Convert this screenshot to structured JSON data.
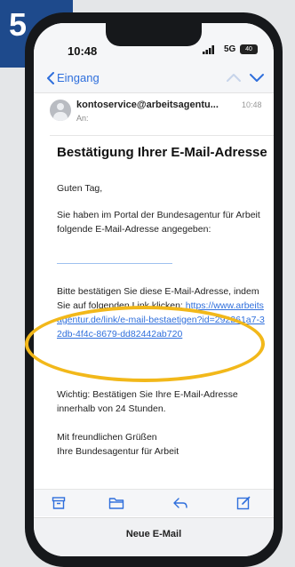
{
  "step": "5",
  "status": {
    "time": "10:48",
    "network": "5G",
    "battery": "40"
  },
  "nav": {
    "back_label": "Eingang"
  },
  "email": {
    "sender": "kontoservice@arbeitsagentu...",
    "time": "10:48",
    "to_label": "An:",
    "subject": "Bestätigung Ihrer E-Mail-Adresse",
    "greeting": "Guten Tag,",
    "intro": "Sie haben im Portal der Bundesagentur für Arbeit folgende E-Mail-Adresse angegeben:",
    "confirm_text": "Bitte bestätigen Sie diese E-Mail-Adresse, indem Sie auf folgenden Link klicken:",
    "link": "https://www.arbeitsagentur.de/link/e-mail-bestaetigen?id=292261a7-32db-4f4c-8679-dd82442ab720",
    "notice": "Wichtig: Bestätigen Sie Ihre E-Mail-Adresse innerhalb von 24 Stunden.",
    "closing": "Mit freundlichen Grüßen",
    "signature": "Ihre Bundesagentur für Arbeit"
  },
  "compose_label": "Neue E-Mail",
  "colors": {
    "badge": "#1e4a8c",
    "link": "#2f6fdc",
    "highlight": "#f2b81a"
  },
  "icons": [
    "chevron-left-icon",
    "chevron-up-icon",
    "chevron-down-icon",
    "archive-icon",
    "folder-icon",
    "reply-icon",
    "compose-icon"
  ]
}
